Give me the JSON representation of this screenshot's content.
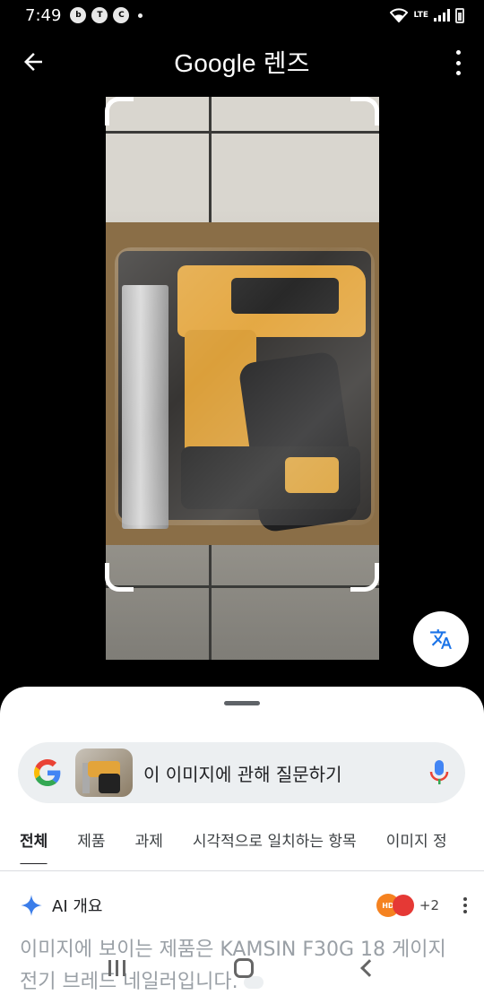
{
  "status_bar": {
    "time": "7:49",
    "network": "LTE"
  },
  "header": {
    "title": "Google 렌즈"
  },
  "search": {
    "placeholder": "이 이미지에 관해 질문하기"
  },
  "tabs": [
    {
      "label": "전체",
      "active": true
    },
    {
      "label": "제품",
      "active": false
    },
    {
      "label": "과제",
      "active": false
    },
    {
      "label": "시각적으로 일치하는 항목",
      "active": false
    },
    {
      "label": "이미지 정",
      "active": false
    }
  ],
  "ai_overview": {
    "label": "AI 개요",
    "sources_more": "+2",
    "text": "이미지에 보이는 제품은 KAMSIN F30G 18 게이지 전기 브레드 네일러입니다."
  },
  "colors": {
    "google_blue": "#4285F4",
    "google_red": "#EA4335",
    "google_yellow": "#FBBC05",
    "google_green": "#34A853"
  },
  "icons": {
    "back": "arrow-left-icon",
    "more": "more-vert-icon",
    "translate": "translate-icon",
    "mic": "mic-icon",
    "spark": "gemini-spark-icon"
  }
}
